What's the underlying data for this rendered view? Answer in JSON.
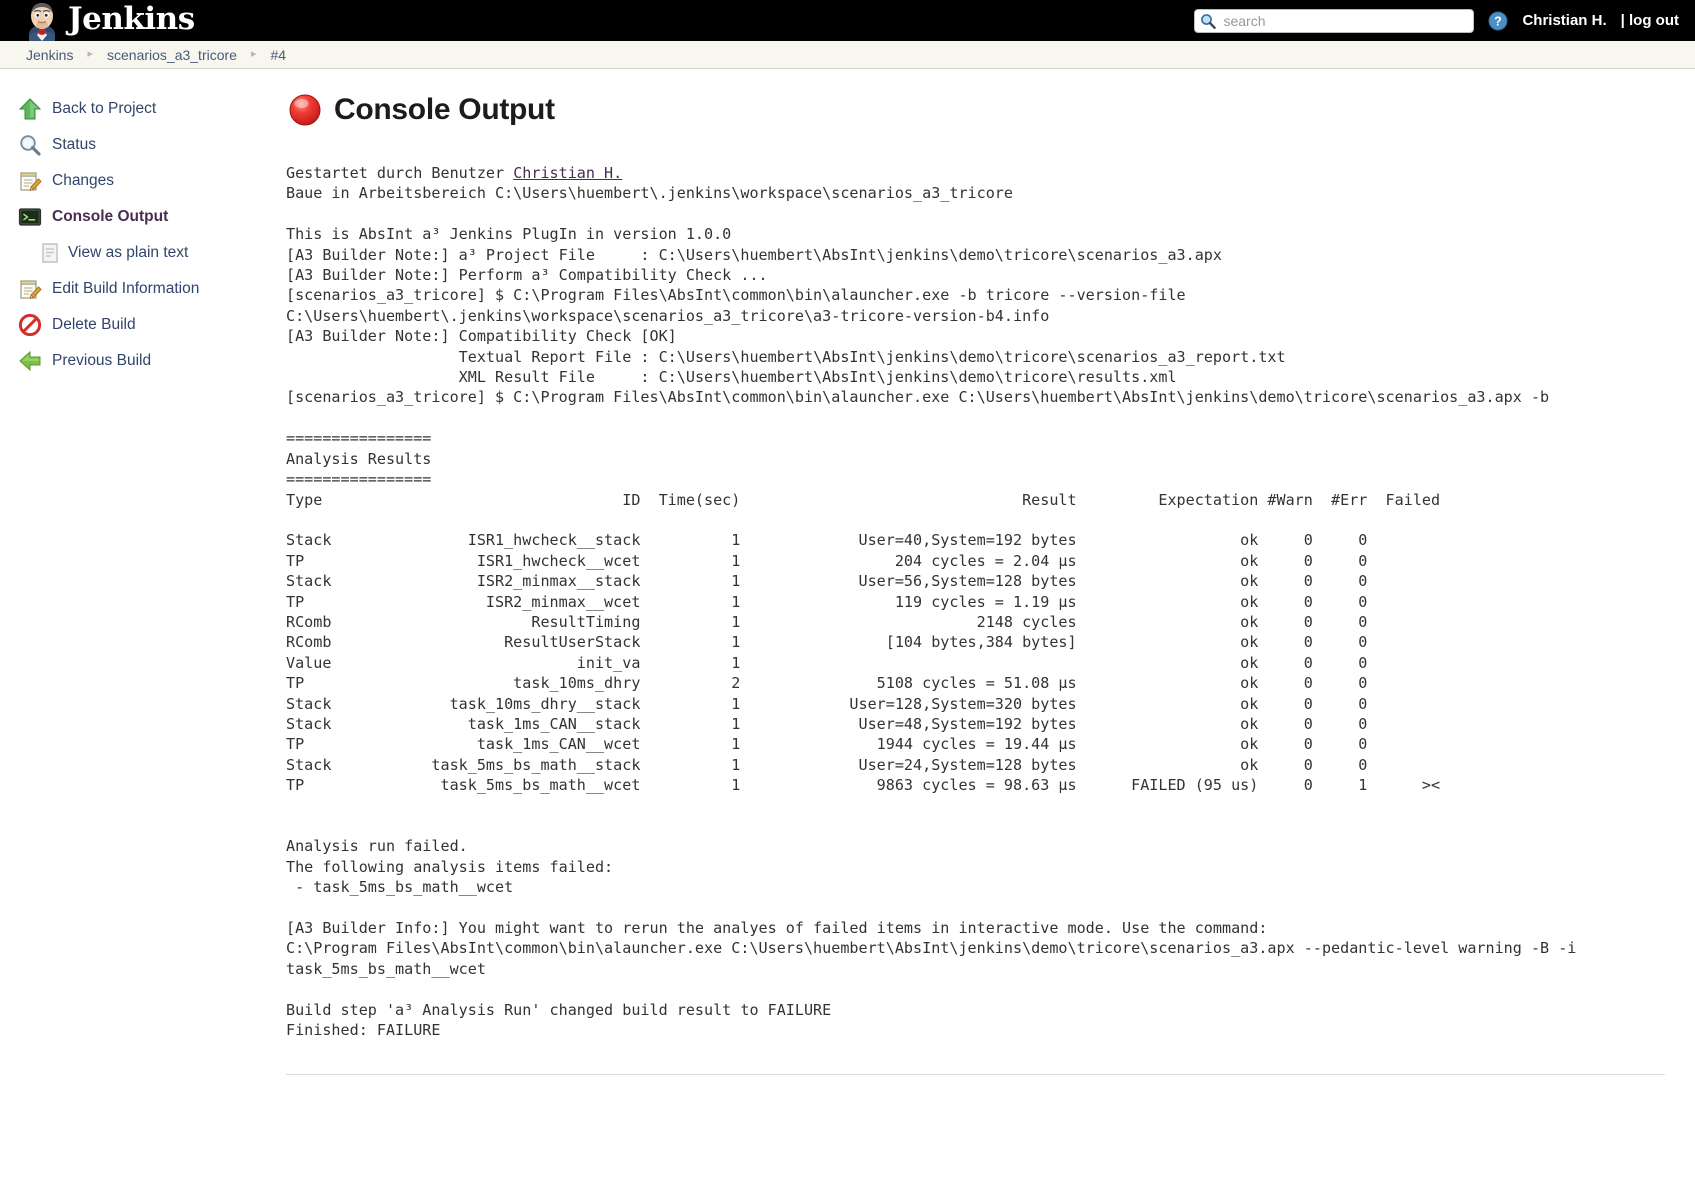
{
  "header": {
    "brand": "Jenkins",
    "brand_icon": "jenkins-butler-logo",
    "search_placeholder": "search",
    "search_value": "",
    "search_icon": "search-icon",
    "help_icon": "help-icon",
    "user_name": "Christian H.",
    "logout_label": "| log out"
  },
  "breadcrumb": {
    "items": [
      {
        "label": "Jenkins"
      },
      {
        "label": "scenarios_a3_tricore"
      },
      {
        "label": "#4"
      }
    ],
    "separator": "▸"
  },
  "sidebar": {
    "items": [
      {
        "label": "Back to Project",
        "icon": "up-arrow-icon",
        "active": false,
        "sub": false
      },
      {
        "label": "Status",
        "icon": "magnifier-icon",
        "active": false,
        "sub": false
      },
      {
        "label": "Changes",
        "icon": "notepad-pencil-icon",
        "active": false,
        "sub": false
      },
      {
        "label": "Console Output",
        "icon": "terminal-icon",
        "active": true,
        "sub": false
      },
      {
        "label": "View as plain text",
        "icon": "document-icon",
        "active": false,
        "sub": true
      },
      {
        "label": "Edit Build Information",
        "icon": "notepad-pencil-icon",
        "active": false,
        "sub": false
      },
      {
        "label": "Delete Build",
        "icon": "no-entry-icon",
        "active": false,
        "sub": false
      },
      {
        "label": "Previous Build",
        "icon": "left-arrow-icon",
        "active": false,
        "sub": false
      }
    ]
  },
  "main": {
    "title": "Console Output",
    "status_icon": "red-ball-failure-icon",
    "status_color": "#e02c2c"
  },
  "console": {
    "started_by_prefix": "Gestartet durch Benutzer ",
    "started_by_user": "Christian H.",
    "workspace_line": "Baue in Arbeitsbereich C:\\Users\\huembert\\.jenkins\\workspace\\scenarios_a3_tricore",
    "lines_intro": [
      "",
      "This is AbsInt a³ Jenkins PlugIn in version 1.0.0",
      "[A3 Builder Note:] a³ Project File     : C:\\Users\\huembert\\AbsInt\\jenkins\\demo\\tricore\\scenarios_a3.apx",
      "[A3 Builder Note:] Perform a³ Compatibility Check ...",
      "[scenarios_a3_tricore] $ C:\\Program Files\\AbsInt\\common\\bin\\alauncher.exe -b tricore --version-file C:\\Users\\huembert\\.jenkins\\workspace\\scenarios_a3_tricore\\a3-tricore-version-b4.info",
      "[A3 Builder Note:] Compatibility Check [OK]",
      "                   Textual Report File : C:\\Users\\huembert\\AbsInt\\jenkins\\demo\\tricore\\scenarios_a3_report.txt",
      "                   XML Result File     : C:\\Users\\huembert\\AbsInt\\jenkins\\demo\\tricore\\results.xml",
      "[scenarios_a3_tricore] $ C:\\Program Files\\AbsInt\\common\\bin\\alauncher.exe C:\\Users\\huembert\\AbsInt\\jenkins\\demo\\tricore\\scenarios_a3.apx -b",
      "",
      ""
    ],
    "results_rule": "================",
    "results_heading": "Analysis Results",
    "table": {
      "columns": [
        "Type",
        "ID",
        "Time(sec)",
        "Result",
        "Expectation",
        "#Warn",
        "#Err",
        "Failed"
      ],
      "rows": [
        {
          "type": "Stack",
          "id": "ISR1_hwcheck__stack",
          "time": "1",
          "result": "User=40,System=192 bytes",
          "expectation": "ok",
          "warn": "0",
          "err": "0",
          "failed": ""
        },
        {
          "type": "TP",
          "id": "ISR1_hwcheck__wcet",
          "time": "1",
          "result": "204 cycles = 2.04 µs",
          "expectation": "ok",
          "warn": "0",
          "err": "0",
          "failed": ""
        },
        {
          "type": "Stack",
          "id": "ISR2_minmax__stack",
          "time": "1",
          "result": "User=56,System=128 bytes",
          "expectation": "ok",
          "warn": "0",
          "err": "0",
          "failed": ""
        },
        {
          "type": "TP",
          "id": "ISR2_minmax__wcet",
          "time": "1",
          "result": "119 cycles = 1.19 µs",
          "expectation": "ok",
          "warn": "0",
          "err": "0",
          "failed": ""
        },
        {
          "type": "RComb",
          "id": "ResultTiming",
          "time": "1",
          "result": "2148 cycles",
          "expectation": "ok",
          "warn": "0",
          "err": "0",
          "failed": ""
        },
        {
          "type": "RComb",
          "id": "ResultUserStack",
          "time": "1",
          "result": "[104 bytes,384 bytes]",
          "expectation": "ok",
          "warn": "0",
          "err": "0",
          "failed": ""
        },
        {
          "type": "Value",
          "id": "init_va",
          "time": "1",
          "result": "",
          "expectation": "ok",
          "warn": "0",
          "err": "0",
          "failed": ""
        },
        {
          "type": "TP",
          "id": "task_10ms_dhry",
          "time": "2",
          "result": "5108 cycles = 51.08 µs",
          "expectation": "ok",
          "warn": "0",
          "err": "0",
          "failed": ""
        },
        {
          "type": "Stack",
          "id": "task_10ms_dhry__stack",
          "time": "1",
          "result": "User=128,System=320 bytes",
          "expectation": "ok",
          "warn": "0",
          "err": "0",
          "failed": ""
        },
        {
          "type": "Stack",
          "id": "task_1ms_CAN__stack",
          "time": "1",
          "result": "User=48,System=192 bytes",
          "expectation": "ok",
          "warn": "0",
          "err": "0",
          "failed": ""
        },
        {
          "type": "TP",
          "id": "task_1ms_CAN__wcet",
          "time": "1",
          "result": "1944 cycles = 19.44 µs",
          "expectation": "ok",
          "warn": "0",
          "err": "0",
          "failed": ""
        },
        {
          "type": "Stack",
          "id": "task_5ms_bs_math__stack",
          "time": "1",
          "result": "User=24,System=128 bytes",
          "expectation": "ok",
          "warn": "0",
          "err": "0",
          "failed": ""
        },
        {
          "type": "TP",
          "id": "task_5ms_bs_math__wcet",
          "time": "1",
          "result": "9863 cycles = 98.63 µs",
          "expectation": "FAILED (95 us)",
          "warn": "0",
          "err": "1",
          "failed": "><"
        }
      ]
    },
    "lines_outro": [
      "",
      "",
      "Analysis run failed.",
      "The following analysis items failed:",
      " - task_5ms_bs_math__wcet",
      "",
      "[A3 Builder Info:] You might want to rerun the analyes of failed items in interactive mode. Use the command:",
      "C:\\Program Files\\AbsInt\\common\\bin\\alauncher.exe C:\\Users\\huembert\\AbsInt\\jenkins\\demo\\tricore\\scenarios_a3.apx --pedantic-level warning -B -i task_5ms_bs_math__wcet",
      "",
      "Build step 'a³ Analysis Run' changed build result to FAILURE",
      "Finished: FAILURE"
    ]
  }
}
